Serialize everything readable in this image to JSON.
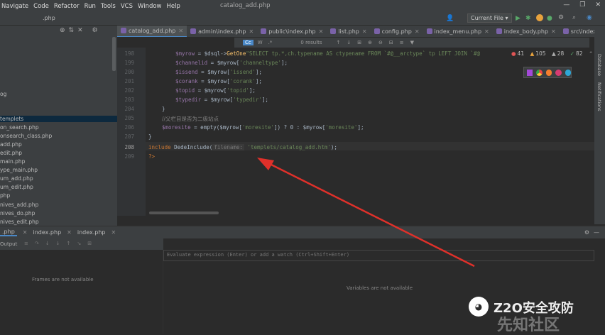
{
  "menu": [
    "Navigate",
    "Code",
    "Refactor",
    "Run",
    "Tools",
    "VCS",
    "Window",
    "Help"
  ],
  "window_title": "catalog_add.php",
  "toolbar": {
    "breadcrumb": ".php",
    "run_config": "Current File"
  },
  "project_tree": [
    "og",
    "templets",
    "on_search.php",
    "onsearch_class.php",
    "add.php",
    "edit.php",
    "main.php",
    "ype_main.php",
    "um_add.php",
    "um_edit.php",
    "php",
    "nives_add.php",
    "nives_do.php",
    "nives_edit.php"
  ],
  "tabs": [
    "catalog_add.php",
    "admin\\index.php",
    "public\\index.php",
    "list.php",
    "config.php",
    "index_menu.php",
    "index_body.php",
    "src\\index.ph"
  ],
  "findbar": {
    "cc": "Cc",
    "w": "W",
    "results": "0 results"
  },
  "inspections": {
    "errors": "41",
    "warnings": "105",
    "weak": "28",
    "typos": "82"
  },
  "lines": [
    "198",
    "199",
    "200",
    "201",
    "202",
    "203",
    "204",
    "205",
    "206",
    "207",
    "208",
    "209"
  ],
  "code": {
    "l198_a": "$myrow",
    "l198_b": " = $dsql->",
    "l198_fn": "GetOne",
    "l198_str": "\"SELECT tp.*,ch.typename AS ctypename FROM `#@__arctype` tp LEFT JOIN `#@",
    "l199_v": "$channelid",
    "l199_m": " = $myrow[",
    "l199_s": "'channeltype'",
    "l199_e": "];",
    "l200_v": "$issend",
    "l200_m": " = $myrow[",
    "l200_s": "'issend'",
    "l200_e": "];",
    "l201_v": "$corank",
    "l201_m": " = $myrow[",
    "l201_s": "'corank'",
    "l201_e": "];",
    "l202_v": "$topid",
    "l202_m": " = $myrow[",
    "l202_s": "'topid'",
    "l202_e": "];",
    "l203_v": "$typedir",
    "l203_m": " = $myrow[",
    "l203_s": "'typedir'",
    "l203_e": "];",
    "l204": "}",
    "l205": "//父栏目是否为二级站点",
    "l206_v": "$moresite",
    "l206_m": " = empty($myrow[",
    "l206_s": "'moresite'",
    "l206_m2": "]) ? 0 : $myrow[",
    "l206_s2": "'moresite'",
    "l206_e": "];",
    "l207": "}",
    "l208_kw": "include",
    "l208_fn": " DedeInclude(",
    "l208_hint": "filename:",
    "l208_s": "'templets/catalog_add.htm'",
    "l208_e": ");",
    "l209": "?>"
  },
  "bottom_tabs": [
    ".php",
    "index.php",
    "index.php"
  ],
  "output_label": "Output",
  "frames_empty": "Frames are not available",
  "eval_placeholder": "Evaluate expression (Enter) or add a watch (Ctrl+Shift+Enter)",
  "vars_empty": "Variables are not available",
  "side_labels": {
    "database": "Database",
    "notifications": "Notifications"
  },
  "watermark": {
    "brand": "Z2O安全攻防",
    "site": "先知社区"
  },
  "colors": {
    "accent": "#4a88c7",
    "arrow": "#e0302a"
  }
}
